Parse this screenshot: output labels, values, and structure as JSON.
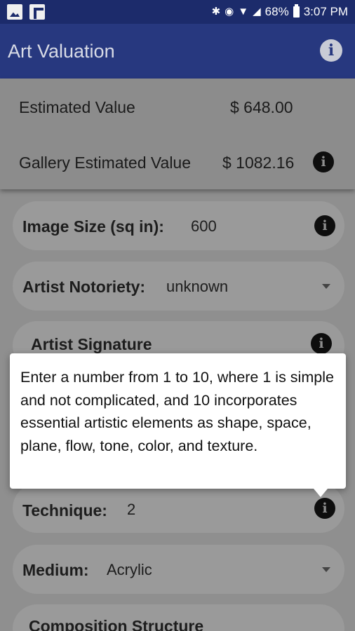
{
  "status_bar": {
    "battery": "68%",
    "time": "3:07 PM",
    "icons": [
      "image-notification-icon",
      "flipboard-icon",
      "bluetooth-icon",
      "hotspot-icon",
      "wifi-icon",
      "signal-icon",
      "battery-icon"
    ]
  },
  "app_bar": {
    "title": "Art Valuation",
    "info_icon": "info-icon"
  },
  "values": {
    "estimated_label": "Estimated Value",
    "estimated_amount": "$ 648.00",
    "gallery_label": "Gallery Estimated Value",
    "gallery_amount": "$ 1082.16"
  },
  "fields": {
    "image_size": {
      "label": "Image Size (sq in):",
      "value": "600"
    },
    "artist_notoriety": {
      "label": "Artist Notoriety:",
      "value": "unknown"
    },
    "artist_signature": {
      "label": "Artist Signature"
    },
    "technique": {
      "label": "Technique:",
      "value": "2"
    },
    "medium": {
      "label": "Medium:",
      "value": "Acrylic"
    },
    "composition": {
      "label": "Composition Structure"
    }
  },
  "tooltip": {
    "text": "Enter a number from 1 to 10, where 1 is simple and not complicated, and 10 incorporates essential artistic elements as shape, space, plane, flow, tone, color, and texture."
  },
  "colors": {
    "app_bar": "#27387f",
    "status_bar": "#1c2b6b",
    "dim_background": "#8f8f8f",
    "tooltip_bg": "#ffffff"
  }
}
